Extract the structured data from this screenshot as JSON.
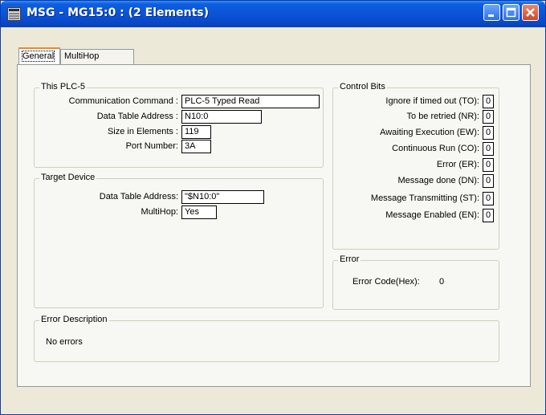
{
  "window": {
    "title": "MSG - MG15:0 : (2 Elements)"
  },
  "tabs": [
    {
      "label": "General"
    },
    {
      "label": "MultiHop"
    }
  ],
  "this_plc": {
    "legend": "This PLC-5",
    "fields": [
      {
        "label": "Communication Command :",
        "value": "PLC-5 Typed Read"
      },
      {
        "label": "Data Table Address :",
        "value": "N10:0"
      },
      {
        "label": "Size in Elements :",
        "value": "119"
      },
      {
        "label": "Port Number:",
        "value": "3A"
      }
    ]
  },
  "target_device": {
    "legend": "Target Device",
    "fields": [
      {
        "label": "Data Table Address:",
        "value": "\"$N10:0\""
      },
      {
        "label": "MultiHop:",
        "value": "Yes"
      }
    ]
  },
  "control_bits": {
    "legend": "Control Bits",
    "bits": [
      {
        "label": "Ignore if timed out (TO):",
        "value": "0"
      },
      {
        "label": "To be retried (NR):",
        "value": "0"
      },
      {
        "label": "Awaiting Execution (EW):",
        "value": "0"
      },
      {
        "label": "Continuous Run (CO):",
        "value": "0"
      },
      {
        "label": "Error (ER):",
        "value": "0"
      },
      {
        "label": "Message done (DN):",
        "value": "0"
      },
      {
        "label": "Message Transmitting (ST):",
        "value": "0"
      },
      {
        "label": "Message Enabled (EN):",
        "value": "0"
      }
    ]
  },
  "error": {
    "legend": "Error",
    "code_label": "Error Code(Hex):",
    "code_value": "0"
  },
  "error_description": {
    "legend": "Error Description",
    "text": "No errors"
  }
}
